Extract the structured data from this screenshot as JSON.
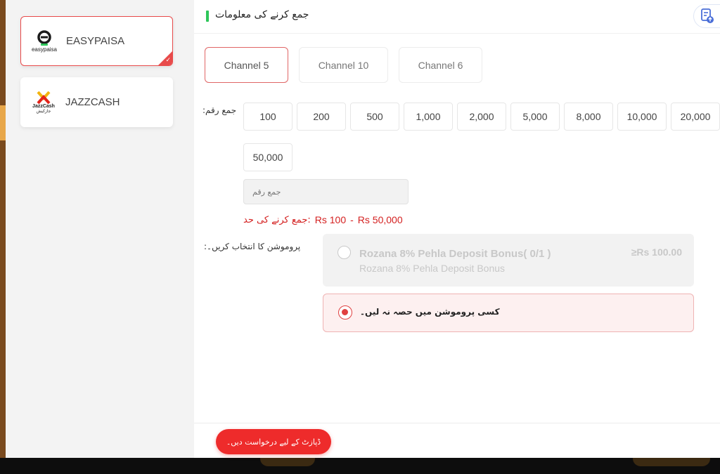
{
  "header": {
    "title": "جمع کرنے کی معلومات"
  },
  "payment_methods": [
    {
      "name": "EASYPAISA",
      "logo_text": "easypaisa",
      "selected": true
    },
    {
      "name": "JAZZCASH",
      "logo_text": "JazzCash",
      "logo_text_urdu": "جازکیش",
      "selected": false
    }
  ],
  "channels": [
    {
      "label": "Channel 5",
      "selected": true
    },
    {
      "label": "Channel 10",
      "selected": false
    },
    {
      "label": "Channel 6",
      "selected": false
    }
  ],
  "amount": {
    "label": ":جمع رقم",
    "options": [
      "100",
      "200",
      "500",
      "1,000",
      "2,000",
      "5,000",
      "8,000",
      "10,000",
      "20,000",
      "50,000"
    ],
    "input_placeholder": "جمع رقم",
    "limit_label": "جمع کرنے کی حد:",
    "limit_min": "Rs  100",
    "limit_sep": "-",
    "limit_max": "Rs  50,000"
  },
  "promotion": {
    "label": ":پروموشن کا انتخاب کریں۔",
    "offer_title": "Rozana 8% Pehla Deposit Bonus( 0/1 )",
    "offer_subtitle": "Rozana 8% Pehla Deposit Bonus",
    "offer_min": "≥Rs  100.00",
    "none_label": "کسی پروموشن میں حصہ نہ لیں۔",
    "selected": "none"
  },
  "footer": {
    "submit_label": "ڈپازٹ کے لیے درخواست دیں۔"
  },
  "colors": {
    "accent": "#ee2b2b",
    "title_bar": "#2ec65a"
  }
}
